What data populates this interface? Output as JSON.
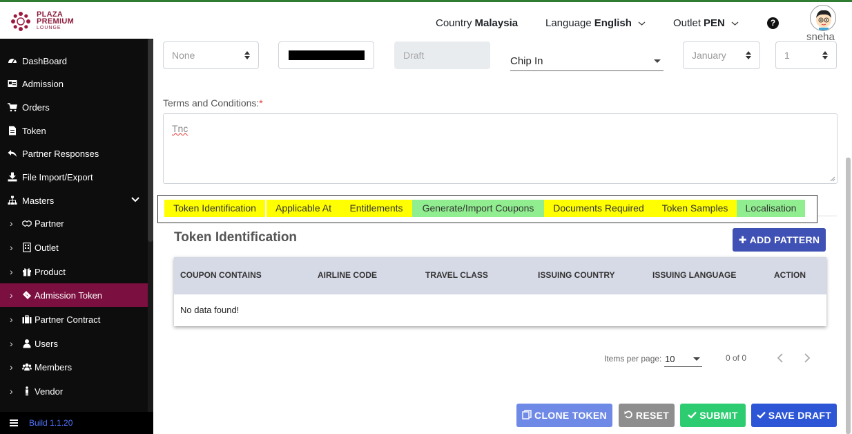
{
  "brand": {
    "line1": "PLAZA",
    "line2": "PREMIUM",
    "line3": "LOUNGE"
  },
  "header": {
    "country_label": "Country",
    "country_value": "Malaysia",
    "language_label": "Language",
    "language_value": "English",
    "outlet_label": "Outlet",
    "outlet_value": "PEN",
    "help": "?",
    "user": "sneha"
  },
  "sidebar": {
    "items": [
      {
        "label": "DashBoard"
      },
      {
        "label": "Admission"
      },
      {
        "label": "Orders"
      },
      {
        "label": "Token"
      },
      {
        "label": "Partner Responses"
      },
      {
        "label": "File Import/Export"
      },
      {
        "label": "Masters"
      }
    ],
    "subitems": [
      {
        "label": "Partner"
      },
      {
        "label": "Outlet"
      },
      {
        "label": "Product"
      },
      {
        "label": "Admission Token"
      },
      {
        "label": "Partner Contract"
      },
      {
        "label": "Users"
      },
      {
        "label": "Members"
      },
      {
        "label": "Vendor"
      }
    ],
    "build": "Build 1.1.20"
  },
  "form": {
    "select1": "None",
    "status": "Draft",
    "chip": "Chip In",
    "month": "January",
    "day": "1",
    "tnc_label": "Terms and Conditions:",
    "tnc_required": "*",
    "tnc_value": "Tnc"
  },
  "tabs": [
    {
      "label": "Token Identification",
      "color": "#ffff00"
    },
    {
      "label": "Applicable At",
      "color": "#ffff00"
    },
    {
      "label": "Entitlements",
      "color": "#ffff00"
    },
    {
      "label": "Generate/Import Coupons",
      "color": "#90ee90"
    },
    {
      "label": "Documents Required",
      "color": "#ffff00"
    },
    {
      "label": "Token Samples",
      "color": "#ffff00"
    },
    {
      "label": "Localisation",
      "color": "#90ee90"
    }
  ],
  "section": {
    "title": "Token Identification",
    "add_button": "ADD PATTERN",
    "columns": [
      "COUPON CONTAINS",
      "AIRLINE CODE",
      "TRAVEL CLASS",
      "ISSUING COUNTRY",
      "ISSUING LANGUAGE",
      "ACTION"
    ],
    "empty": "No data found!"
  },
  "pager": {
    "label": "Items per page:",
    "size": "10",
    "range": "0 of 0"
  },
  "actions": {
    "clone": "CLONE TOKEN",
    "reset": "RESET",
    "submit": "SUBMIT",
    "save": "SAVE DRAFT"
  }
}
